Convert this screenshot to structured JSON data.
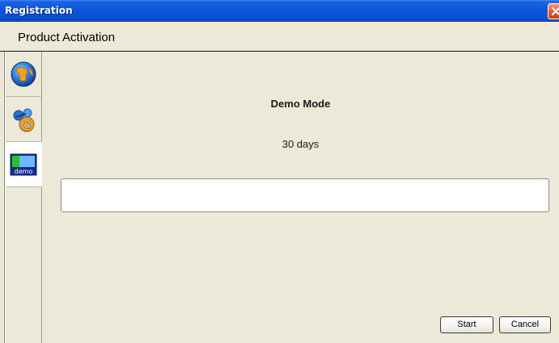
{
  "window": {
    "title": "Registration"
  },
  "header": {
    "title": "Product Activation"
  },
  "sidebar": {
    "items": [
      {
        "icon": "globe-icon",
        "selected": false
      },
      {
        "icon": "email-at-icon",
        "selected": false
      },
      {
        "icon": "demo-icon",
        "label": "demo",
        "selected": true
      }
    ]
  },
  "main": {
    "mode_title": "Demo Mode",
    "mode_duration": "30 days",
    "text_value": ""
  },
  "buttons": {
    "start_label": "Start",
    "cancel_label": "Cancel"
  },
  "colors": {
    "titlebar": "#0a55dc",
    "close_button": "#e25c35",
    "background": "#ece9d8"
  }
}
